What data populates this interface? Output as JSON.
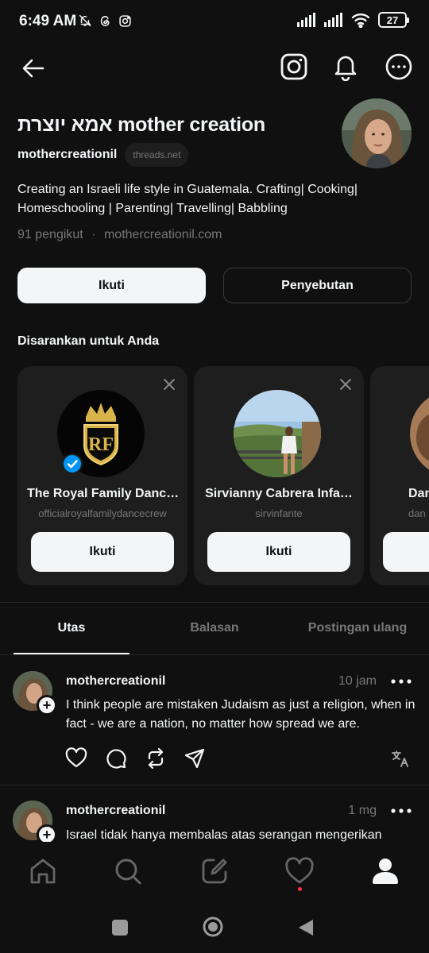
{
  "status_bar": {
    "time": "6:49 AM",
    "battery": "27",
    "icons": [
      "mute-icon",
      "threads-icon",
      "instagram-icon",
      "signal-icon",
      "signal-icon",
      "wifi-icon",
      "battery-icon"
    ]
  },
  "header": {
    "icons": [
      "back-arrow-icon",
      "instagram-icon",
      "bell-icon",
      "more-icon"
    ]
  },
  "profile": {
    "name": "אמא יוצרת mother creation",
    "handle": "mothercreationil",
    "domain_badge": "threads.net",
    "bio": "Creating an Israeli life style in Guatemala. Crafting| Cooking| Homeschooling | Parenting| Travelling| Babbling",
    "followers": "91 pengikut",
    "separator": "·",
    "website": "mothercreationil.com",
    "follow_label": "Ikuti",
    "mention_label": "Penyebutan"
  },
  "suggestions": {
    "title": "Disarankan untuk Anda",
    "cards": [
      {
        "name": "The Royal Family Danc…",
        "handle": "officialroyalfamilydancecrew",
        "button": "Ikuti",
        "verified": true,
        "logo_text": "RF"
      },
      {
        "name": "Sirvianny Cabrera Infa…",
        "handle": "sirvinfante",
        "button": "Ikuti",
        "verified": false
      },
      {
        "name": "Dan",
        "handle": "dan",
        "button": "",
        "verified": false
      }
    ]
  },
  "tabs": [
    {
      "label": "Utas",
      "active": true
    },
    {
      "label": "Balasan",
      "active": false
    },
    {
      "label": "Postingan ulang",
      "active": false
    }
  ],
  "posts": [
    {
      "handle": "mothercreationil",
      "time": "10 jam",
      "text": "I think people are mistaken Judaism as just a religion, when in fact - we are a nation, no matter how spread we are.",
      "actions": [
        "heart-icon",
        "comment-icon",
        "repost-icon",
        "share-icon",
        "translate-icon"
      ]
    },
    {
      "handle": "mothercreationil",
      "time": "1 mg",
      "text": "Israel tidak hanya membalas atas serangan mengerikan"
    }
  ],
  "bottom_nav": {
    "items": [
      "home-icon",
      "search-icon",
      "compose-icon",
      "activity-icon",
      "profile-icon"
    ],
    "activity_dot_color": "#ff3040"
  },
  "colors": {
    "background": "#101010",
    "text": "#f3f5f7",
    "secondary": "#777777",
    "card": "#1e1e1e",
    "verified": "#0095f6"
  }
}
